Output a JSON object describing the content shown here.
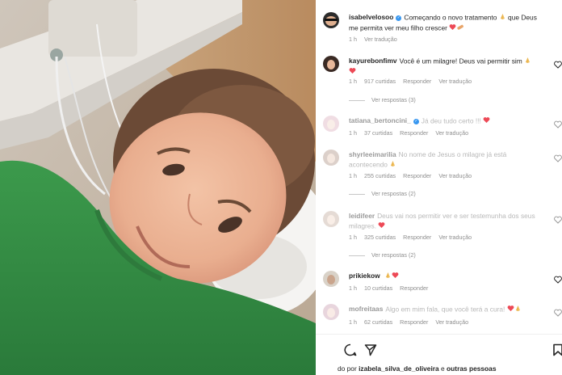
{
  "post": {
    "author": "isabelvelosoo",
    "caption": "Começando o novo tratamento",
    "caption_2": "que Deus me permita ver meu filho crescer",
    "translate": "Ver tradução"
  },
  "comments": [
    {
      "user": "kayurebonfimv",
      "text": "Você é um milagre! Deus vai permitir sim",
      "time": "1 h",
      "likes": "917 curtidas",
      "reply": "Responder",
      "translate": "Ver tradução",
      "replies": "Ver respostas (3)",
      "dim": false
    },
    {
      "user": "tatiana_bertoncini_",
      "text": "Já deu tudo certo !!!",
      "time": "1 h",
      "likes": "37 curtidas",
      "reply": "Responder",
      "translate": "Ver tradução",
      "dim": true
    },
    {
      "user": "shyrleeimarilia",
      "text": "No nome de Jesus o milagre já está acontecendo",
      "time": "1 h",
      "likes": "255 curtidas",
      "reply": "Responder",
      "translate": "Ver tradução",
      "replies": "Ver respostas (2)",
      "dim": true
    },
    {
      "user": "leidifeer",
      "text": "Deus vai nos permitir ver e ser testemunha dos seus milagres.",
      "time": "1 h",
      "likes": "325 curtidas",
      "reply": "Responder",
      "translate": "Ver tradução",
      "replies": "Ver respostas (2)",
      "dim": true
    },
    {
      "user": "prikiekow",
      "text": "",
      "time": "1 h",
      "likes": "10 curtidas",
      "reply": "Responder",
      "dim": false
    },
    {
      "user": "mofreitaas",
      "text": "Algo em mim fala, que você terá a cura!",
      "time": "1 h",
      "likes": "62 curtidas",
      "reply": "Responder",
      "translate": "Ver tradução",
      "dim": true
    }
  ],
  "footer": {
    "liked_prefix": "do por",
    "liked_user": "izabela_silva_de_oliveira",
    "liked_suffix": "e",
    "liked_others": "outras pessoas"
  },
  "colors": {
    "verified": "#3897f0",
    "heart": "#ed4956",
    "text": "#262626",
    "muted": "#8e8e8e"
  },
  "icons": [
    "heart-icon",
    "comment-icon",
    "share-icon",
    "bookmark-icon",
    "verified-icon",
    "pray-emoji-icon",
    "bandage-emoji-icon"
  ]
}
